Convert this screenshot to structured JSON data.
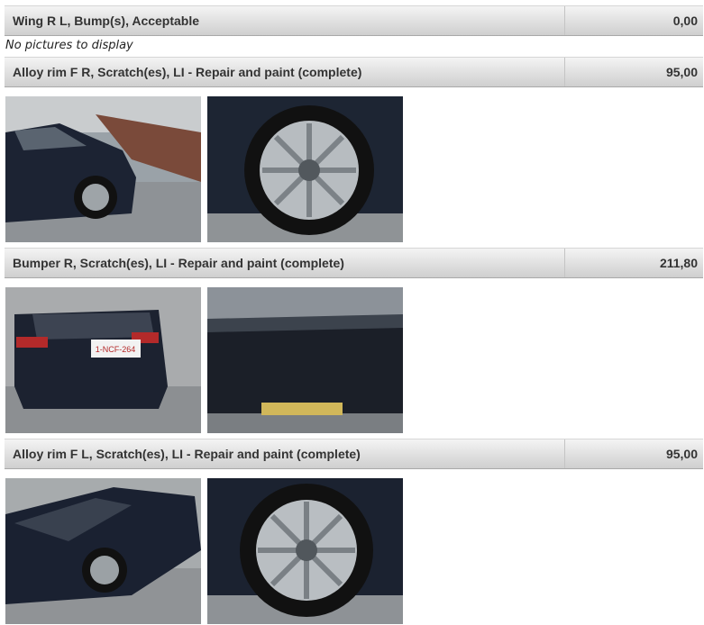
{
  "damage_items": [
    {
      "description": "Wing R L, Bump(s), Acceptable",
      "price": "0,00"
    },
    {
      "description": "Alloy rim F R, Scratch(es), LI - Repair and paint (complete)",
      "price": "95,00"
    },
    {
      "description": "Bumper R, Scratch(es), LI - Repair and paint (complete)",
      "price": "211,80"
    },
    {
      "description": "Alloy rim F L, Scratch(es), LI - Repair and paint (complete)",
      "price": "95,00"
    }
  ],
  "no_pictures_text": "No pictures to display",
  "license_plate": "1-NCF-264"
}
